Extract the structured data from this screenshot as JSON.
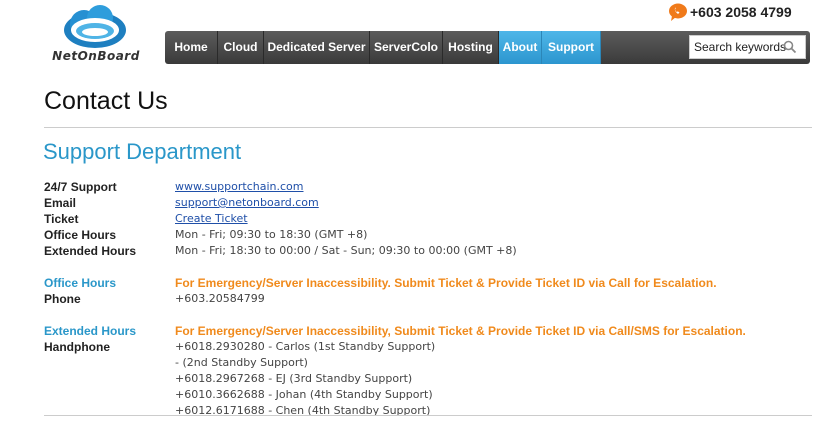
{
  "header": {
    "logo_text": "NetOnBoard",
    "phone": "+603 2058 4799",
    "nav": [
      {
        "label": "Home"
      },
      {
        "label": "Cloud"
      },
      {
        "label": "Dedicated Server"
      },
      {
        "label": "ServerColo"
      },
      {
        "label": "Hosting"
      },
      {
        "label": "About"
      },
      {
        "label": "Support"
      }
    ],
    "search_placeholder": "Search keywords",
    "accent_color": "#2a97c9"
  },
  "page": {
    "title": "Contact Us",
    "section_title": "Support Department"
  },
  "contacts": {
    "support_label": "24/7 Support",
    "support_link": "www.supportchain.com",
    "email_label": "Email",
    "email_link": "support@netonboard.com",
    "ticket_label": "Ticket",
    "ticket_link": "Create Ticket",
    "office_label": "Office Hours",
    "office_value": "Mon - Fri; 09:30 to 18:30 (GMT +8)",
    "extended_label": "Extended Hours",
    "extended_value": "Mon - Fri; 18:30 to 00:00 / Sat - Sun; 09:30 to 00:00 (GMT +8)"
  },
  "office_hours_block": {
    "heading": "Office Hours",
    "notice": "For Emergency/Server Inaccessibility. Submit Ticket & Provide Ticket ID via Call for Escalation.",
    "phone_label": "Phone",
    "phone_value": "+603.20584799"
  },
  "extended_hours_block": {
    "heading": "Extended Hours",
    "notice": "For Emergency/Server Inaccessibility, Submit Ticket & Provide Ticket ID via Call/SMS for Escalation.",
    "handphone_label": "Handphone",
    "numbers": [
      "+6018.2930280 - Carlos (1st Standby Support)",
      "- (2nd Standby Support)",
      "+6018.2967268 - EJ (3rd Standby Support)",
      "+6010.3662688 - Johan (4th Standby Support)",
      "+6012.6171688 - Chen (4th Standby Support)"
    ]
  },
  "notice_color": "#f08a1c"
}
